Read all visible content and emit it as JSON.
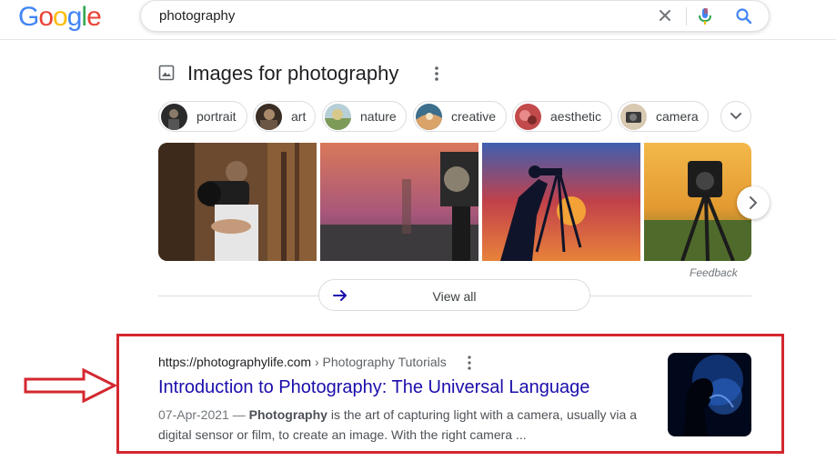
{
  "header": {
    "logo_letters": [
      "G",
      "o",
      "o",
      "g",
      "l",
      "e"
    ],
    "logo_colors": [
      "#4285F4",
      "#EA4335",
      "#FBBC05",
      "#4285F4",
      "#34A853",
      "#EA4335"
    ],
    "search_query": "photography",
    "icons": {
      "clear": "close-icon",
      "mic": "mic-icon",
      "search": "search-icon"
    }
  },
  "images_section": {
    "title": "Images for photography",
    "chips": [
      {
        "label": "portrait"
      },
      {
        "label": "art"
      },
      {
        "label": "nature"
      },
      {
        "label": "creative"
      },
      {
        "label": "aesthetic"
      },
      {
        "label": "camera"
      }
    ],
    "feedback_label": "Feedback",
    "view_all_label": "View all"
  },
  "result": {
    "url": "https://photographylife.com",
    "breadcrumb": " › Photography Tutorials",
    "title": "Introduction to Photography: The Universal Language",
    "date": "07-Apr-2021 —",
    "snippet_bold": "Photography",
    "snippet_rest": " is the art of capturing light with a camera, usually via a digital sensor or film, to create an image. With the right camera ..."
  },
  "colors": {
    "link": "#1a0dab",
    "highlight_box": "#d4272f"
  }
}
